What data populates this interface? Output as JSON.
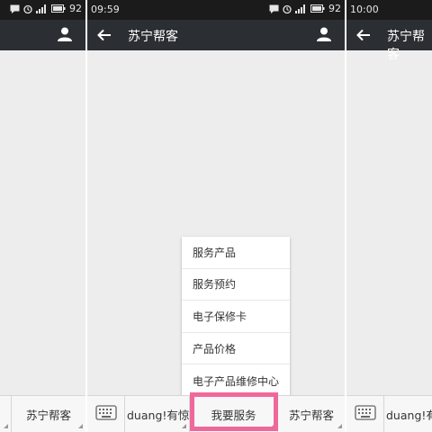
{
  "left_screen": {
    "status": {
      "battery": "92"
    },
    "icons": {
      "person": "person-icon"
    },
    "bottom": {
      "menu_label": "苏宁帮客"
    }
  },
  "middle_screen": {
    "status": {
      "time": "09:59",
      "battery": "92"
    },
    "title": "苏宁帮客",
    "bottom": {
      "tabs": [
        {
          "label": "duang!有惊喜"
        },
        {
          "label": "我要服务"
        },
        {
          "label": "苏宁帮客"
        }
      ]
    },
    "popup_menu": {
      "items": [
        {
          "label": "服务产品"
        },
        {
          "label": "服务预约"
        },
        {
          "label": "电子保修卡"
        },
        {
          "label": "产品价格"
        },
        {
          "label": "电子产品维修中心"
        }
      ]
    }
  },
  "right_screen": {
    "status": {
      "time": "10:00"
    },
    "title": "苏宁帮客",
    "bottom": {
      "tab_label": "duang!有惊"
    }
  },
  "colors": {
    "title_bar": "#2b2f33",
    "status_bar": "#1b1b1b",
    "chat_background": "#ededed",
    "highlight": "#f0689b"
  }
}
